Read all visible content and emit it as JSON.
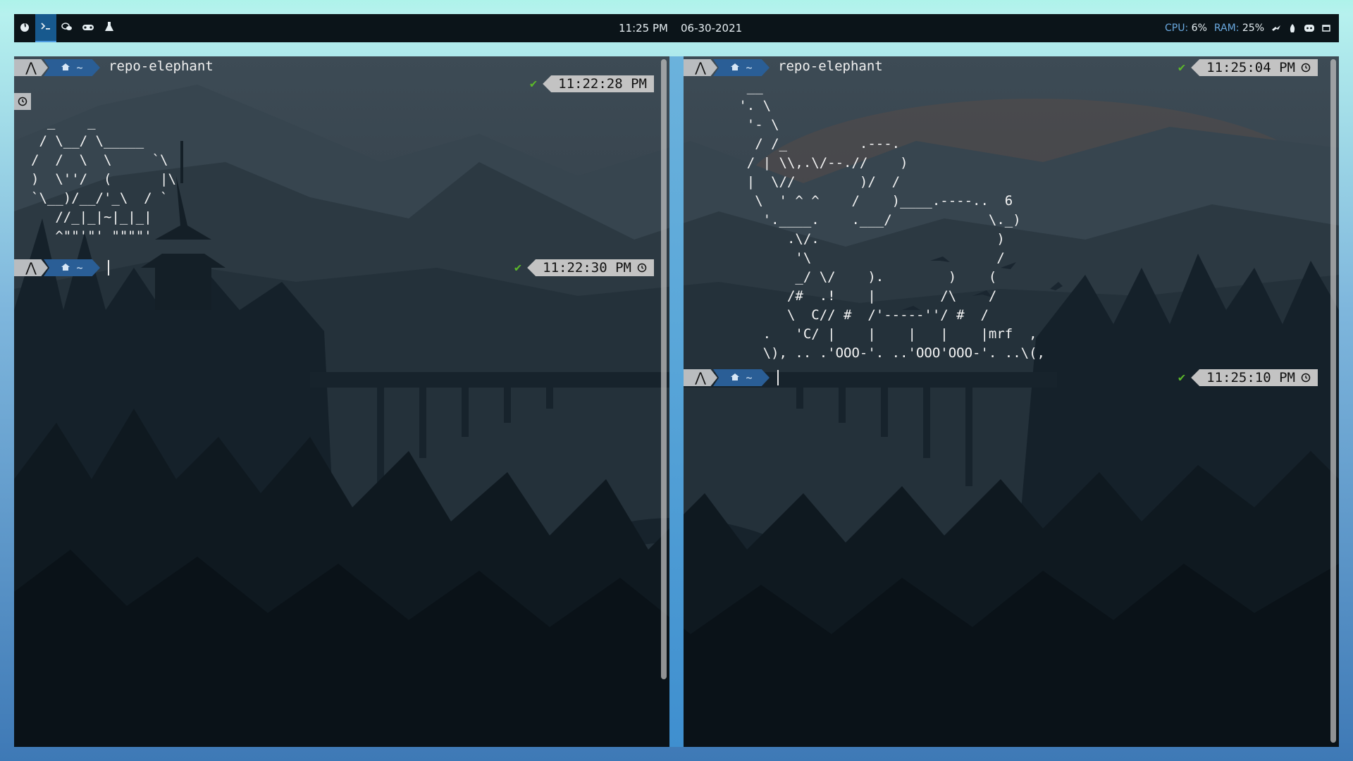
{
  "topbar": {
    "workspaces": [
      {
        "icon": "fire-icon",
        "active": false
      },
      {
        "icon": "terminal-icon",
        "active": true
      },
      {
        "icon": "chat-icon",
        "active": false
      },
      {
        "icon": "gamepad-icon",
        "active": false
      },
      {
        "icon": "flask-icon",
        "active": false
      }
    ],
    "time": "11:25 PM",
    "date": "06-30-2021",
    "cpu_label": "CPU:",
    "cpu_value": "6%",
    "ram_label": "RAM:",
    "ram_value": "25%",
    "tray_icons": [
      "steam-icon",
      "flame-tray-icon",
      "discord-icon",
      "window-icon"
    ]
  },
  "left_terminal": {
    "prompt1": {
      "arch": "⋀",
      "home": "~",
      "dir": "repo-elephant",
      "status": "✔",
      "time": "11:22:28 PM"
    },
    "ascii_art": "  _    _\n / \\__/ \\_____\n/  /  \\  \\     `\\\n)  \\''/  (      |\\\n`\\__)/__/'_\\  / `\n   //_|_|~|_|_|\n   ^\"\"'\"' \"\"\"\"'",
    "prompt2": {
      "arch": "⋀",
      "home": "~",
      "status": "✔",
      "time": "11:22:30 PM"
    }
  },
  "right_terminal": {
    "prompt1": {
      "arch": "⋀",
      "home": "~",
      "dir": "repo-elephant",
      "status": "✔",
      "time": "11:25:04 PM"
    },
    "ascii_art": "    __\n   '. \\\n    '- \\\n     / /_         .---.\n    / | \\\\,.\\/--.//    )\n    |  \\//        )/  /\n     \\  ' ^ ^    /    )____.----..  6\n      '.____.    .___/            \\._)\n         .\\/.                      )\n          '\\                       /\n          _/ \\/    ).        )    (\n         /#  .!    |        /\\    /\n         \\  C// #  /'-----''/ #  /\n      .   'C/ |    |    |   |    |mrf  ,\n      \\), .. .'OOO-'. ..'OOO'OOO-'. ..\\(,",
    "prompt2": {
      "arch": "⋀",
      "home": "~",
      "status": "✔",
      "time": "11:25:10 PM"
    }
  },
  "colors": {
    "topbar_bg": "#0b1419",
    "accent_blue": "#2a5e96",
    "status_green": "#5cb82a",
    "segment_gray": "#c3c3c3"
  }
}
